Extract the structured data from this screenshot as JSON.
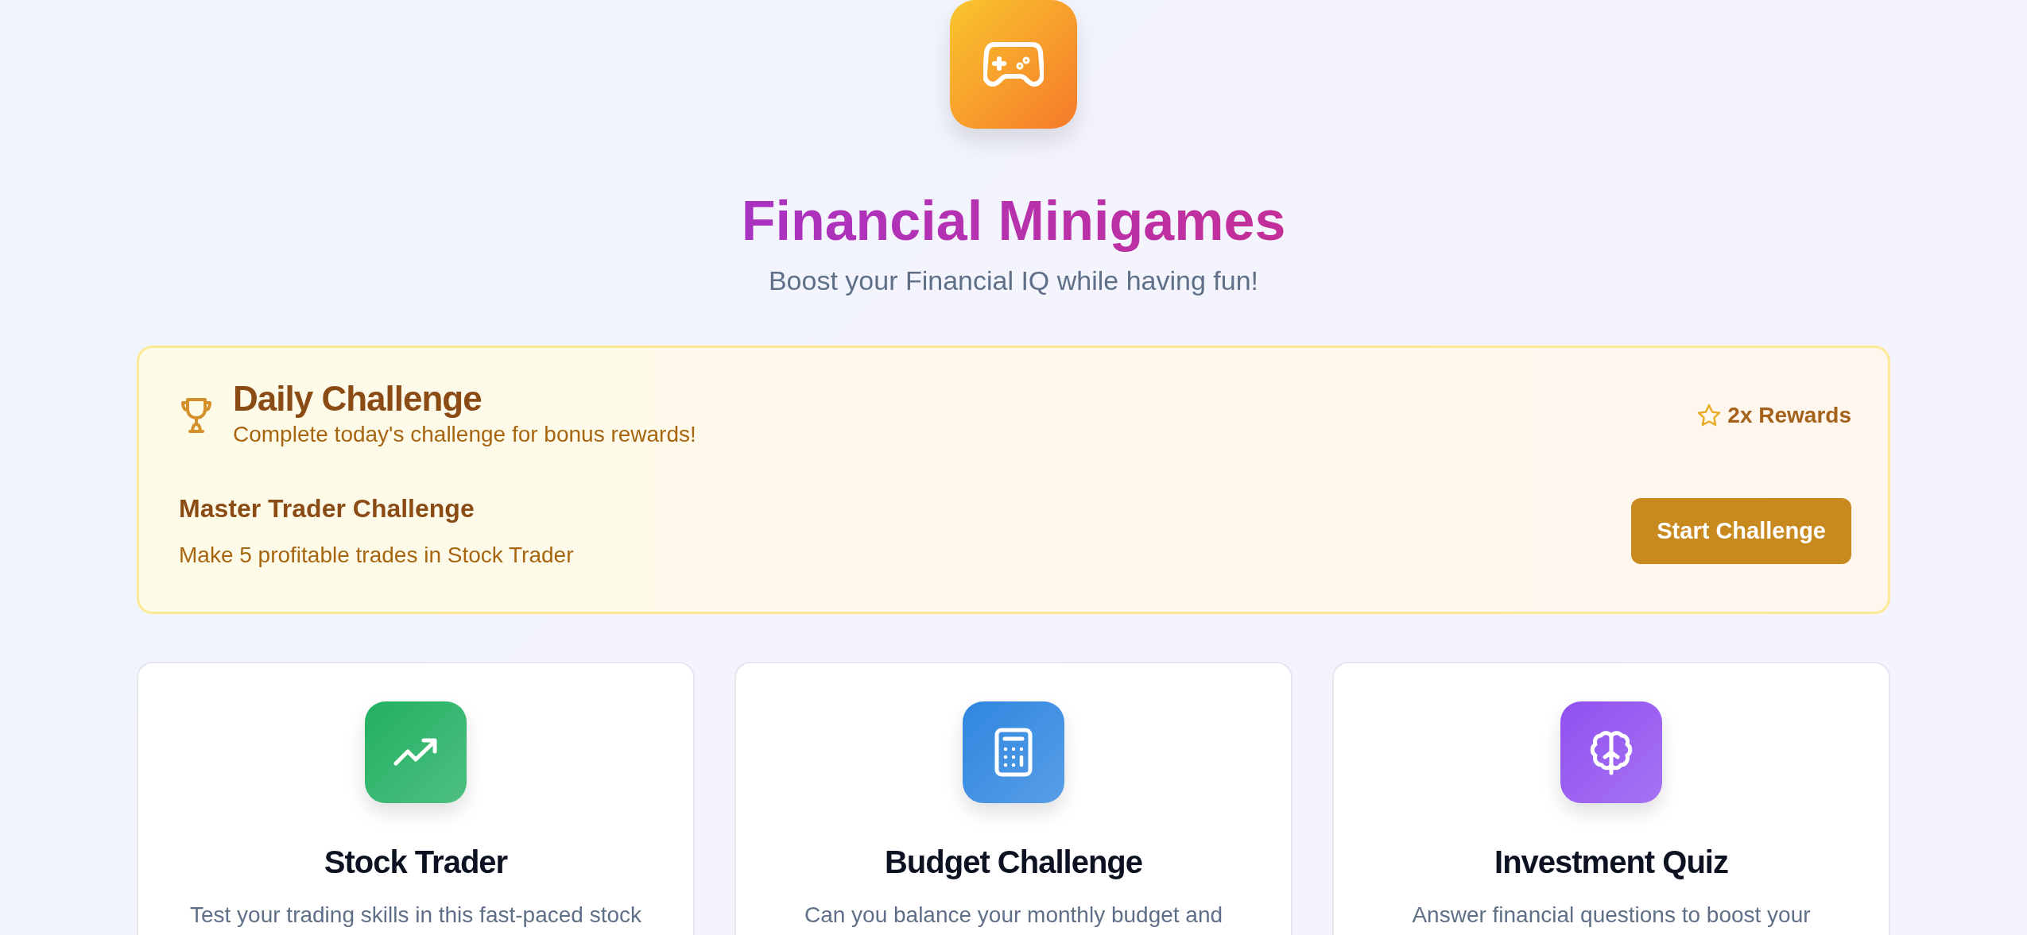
{
  "header": {
    "title": "Financial Minigames",
    "subtitle": "Boost your Financial IQ while having fun!"
  },
  "daily_challenge": {
    "title": "Daily Challenge",
    "subtitle": "Complete today's challenge for bonus rewards!",
    "reward": "2x Rewards",
    "challenge_name": "Master Trader Challenge",
    "challenge_description": "Make 5 profitable trades in Stock Trader",
    "button": "Start Challenge"
  },
  "games": [
    {
      "kind": "chart",
      "title": "Stock Trader",
      "description": "Test your trading skills in this fast-paced stock",
      "color": "#22b062"
    },
    {
      "kind": "calculator",
      "title": "Budget Challenge",
      "description": "Can you balance your monthly budget and",
      "color": "#2f86e0"
    },
    {
      "kind": "brain",
      "title": "Investment Quiz",
      "description": "Answer financial questions to boost your",
      "color": "#9050f0"
    }
  ]
}
